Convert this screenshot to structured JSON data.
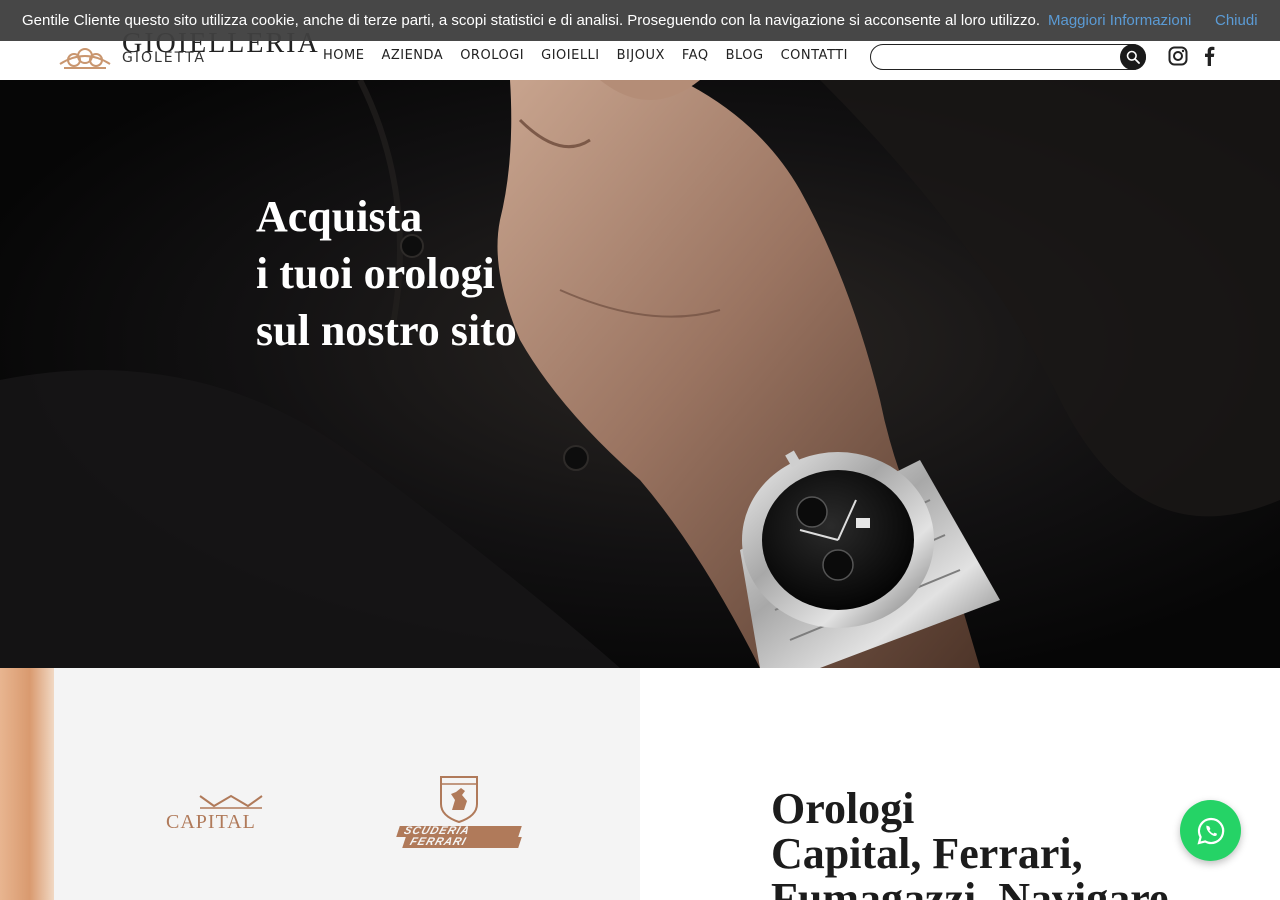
{
  "header": {
    "logo_title": "GIOIELLERIA",
    "logo_subtitle": "GIOLETTA",
    "nav": [
      "HOME",
      "AZIENDA",
      "OROLOGI",
      "GIOIELLI",
      "BIJOUX",
      "FAQ",
      "BLOG",
      "CONTATTI"
    ],
    "search": {
      "value": "",
      "placeholder": ""
    },
    "icons": [
      "search-icon",
      "instagram-icon",
      "facebook-icon"
    ]
  },
  "cookie_bar": {
    "message": "Gentile Cliente questo sito utilizza cookie, anche di terze parti, a scopi statistici e di analisi. Proseguendo con la navigazione si acconsente al loro utilizzo.",
    "more_label": "Maggiori Informazioni",
    "close_label": "Chiudi"
  },
  "hero": {
    "lines": [
      "Acquista",
      "i tuoi orologi",
      "sul nostro sito"
    ]
  },
  "brands": {
    "capital": "CAPITAL",
    "ferrari_line1": "SCUDERIA",
    "ferrari_line2": "FERRARI"
  },
  "section": {
    "title_lines": [
      "Orologi",
      "Capital, Ferrari,",
      "Fumagazzi, Navigare"
    ]
  },
  "colors": {
    "accent_copper": "#b07a5a",
    "link_blue": "#5b9bd5",
    "whatsapp_green": "#25d366",
    "cookie_bg": "#404040"
  }
}
